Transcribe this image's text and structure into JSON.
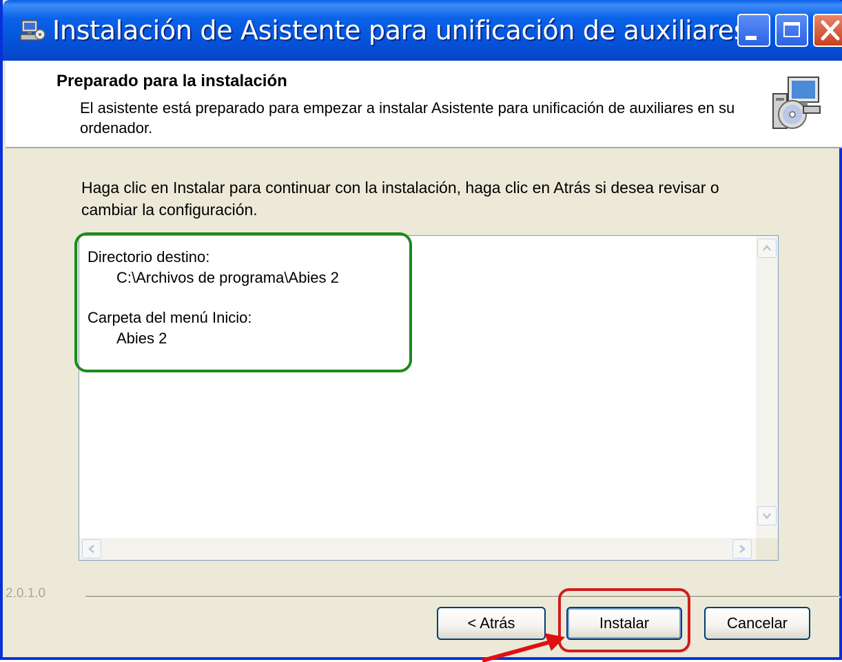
{
  "window": {
    "title": "Instalación de Asistente para unificación de auxiliares"
  },
  "header": {
    "title": "Preparado para la instalación",
    "subtitle": "El asistente está preparado para empezar a instalar Asistente para unificación de auxiliares en su ordenador."
  },
  "body": {
    "instructions": "Haga clic en Instalar para continuar con la instalación, haga clic en Atrás si desea revisar o cambiar la configuración."
  },
  "summary": {
    "dest_label": "Directorio destino:",
    "dest_value": "C:\\Archivos de programa\\Abies 2",
    "start_label": "Carpeta del menú Inicio:",
    "start_value": "Abies 2"
  },
  "footer": {
    "version": "2.0.1.0",
    "back_label": "< Atrás",
    "install_label": "Instalar",
    "cancel_label": "Cancelar"
  },
  "colors": {
    "titlebar": "#0a5fe6",
    "highlight_green": "#1c8a1c",
    "highlight_red": "#d11c1c"
  }
}
